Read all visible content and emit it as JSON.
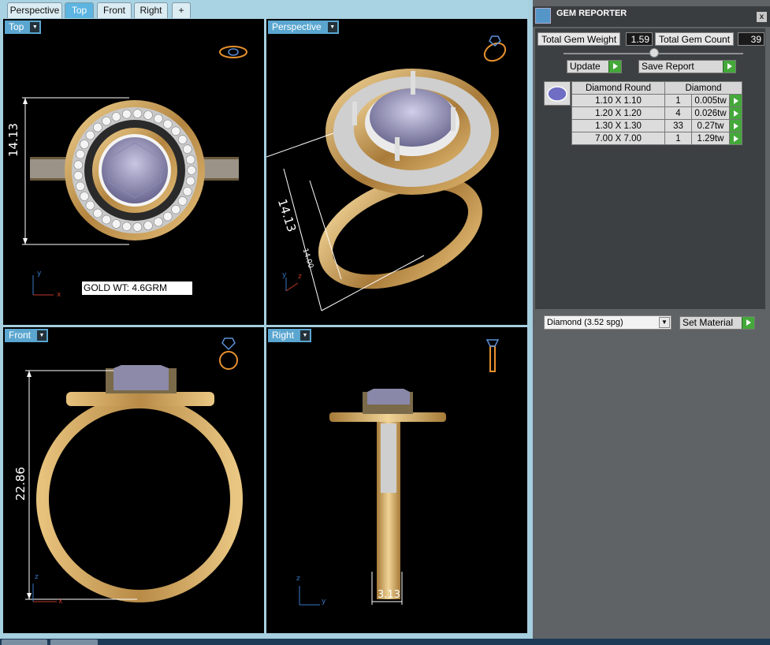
{
  "tabs": [
    {
      "label": "Perspective"
    },
    {
      "label": "Top"
    },
    {
      "label": "Front"
    },
    {
      "label": "Right"
    },
    {
      "label": "+"
    }
  ],
  "viewports": {
    "top": {
      "label": "Top",
      "dimension": "14.13",
      "note": "GOLD WT: 4.6GRM"
    },
    "perspective": {
      "label": "Perspective",
      "dimension": "14.13",
      "dimension2": "14.00"
    },
    "front": {
      "label": "Front",
      "dimension": "22.86"
    },
    "right": {
      "label": "Right",
      "dimension": "3.13"
    }
  },
  "axes": {
    "x": "x",
    "y": "y",
    "z": "z"
  },
  "panel": {
    "title": "GEM REPORTER",
    "close": "x",
    "total_weight_label": "Total Gem Weight",
    "total_weight_value": "1.59",
    "total_count_label": "Total Gem Count",
    "total_count_value": "39",
    "update_label": "Update",
    "save_label": "Save Report",
    "table_header": [
      "Diamond Round",
      "Diamond"
    ],
    "rows": [
      {
        "size": "1.10 X 1.10",
        "count": "1",
        "weight": "0.005tw"
      },
      {
        "size": "1.20 X 1.20",
        "count": "4",
        "weight": "0.026tw"
      },
      {
        "size": "1.30 X 1.30",
        "count": "33",
        "weight": "0.27tw"
      },
      {
        "size": "7.00 X 7.00",
        "count": "1",
        "weight": "1.29tw"
      }
    ],
    "material_value": "Diamond      (3.52 spg)",
    "set_material_label": "Set Material"
  },
  "colors": {
    "gold": "#c9a25a",
    "tab_active": "#5cb4e0",
    "go_green": "#44a83a"
  }
}
